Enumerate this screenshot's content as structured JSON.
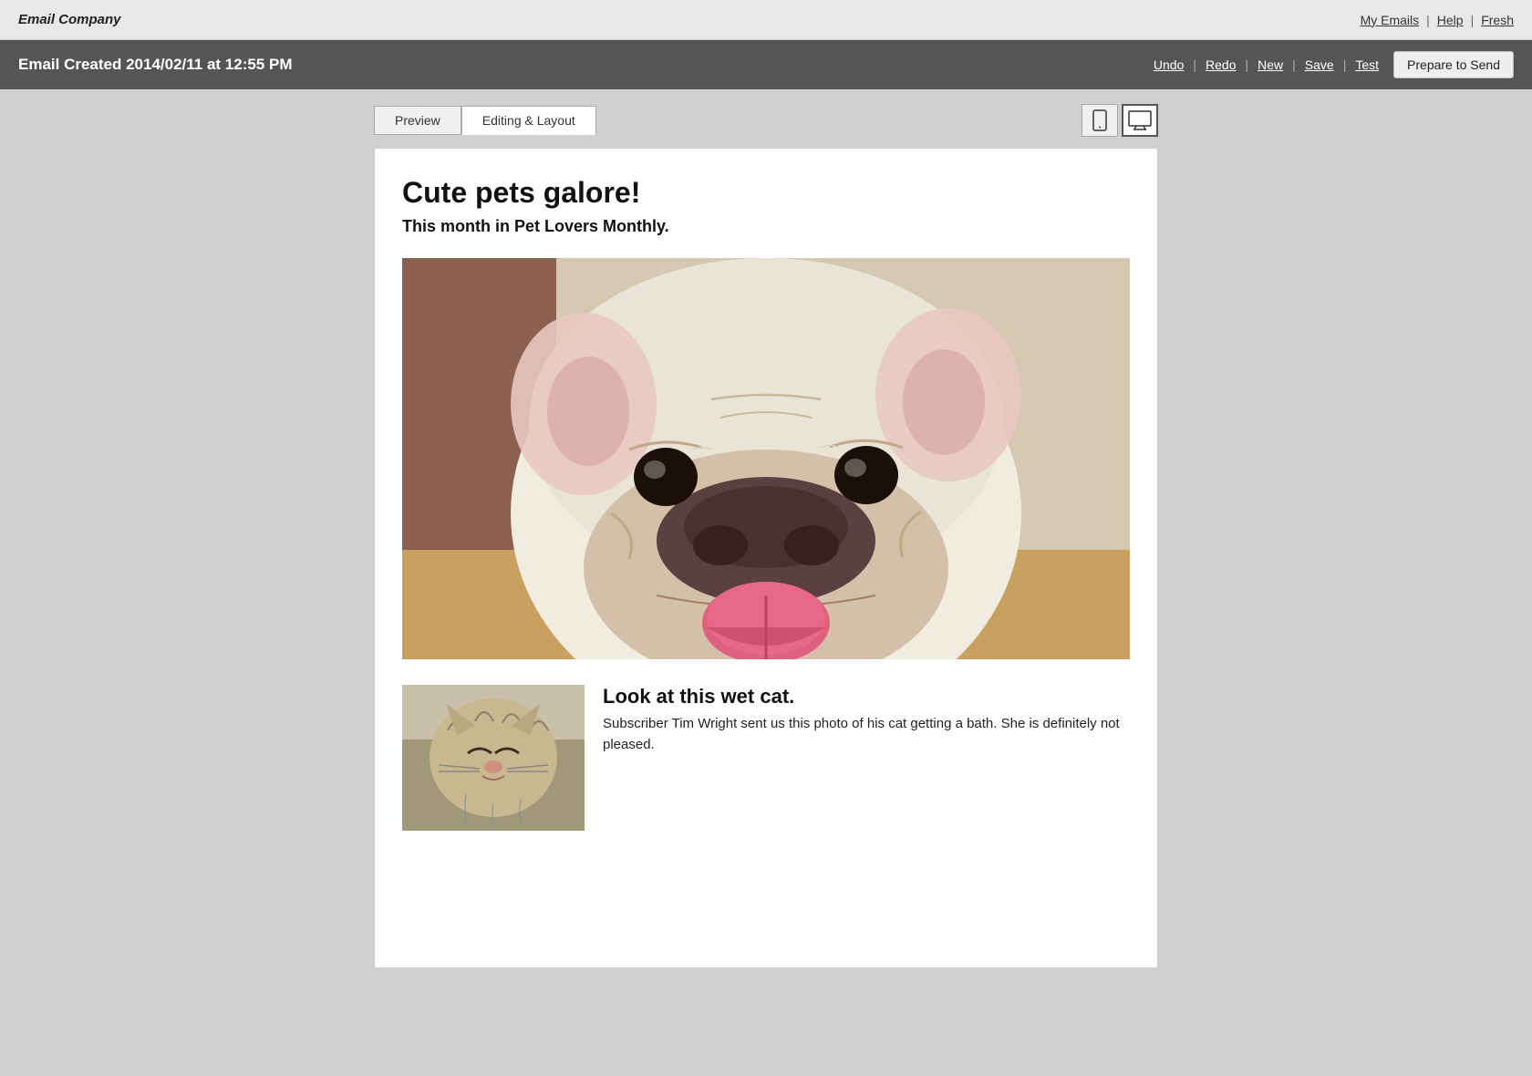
{
  "brand": {
    "name": "Email Company"
  },
  "topnav": {
    "links": [
      {
        "label": "My Emails",
        "id": "my-emails"
      },
      {
        "label": "Help",
        "id": "help"
      },
      {
        "label": "Fresh",
        "id": "fresh"
      }
    ]
  },
  "toolbar": {
    "title": "Email Created 2014/02/11 at 12:55 PM",
    "actions": [
      {
        "label": "Undo",
        "id": "undo"
      },
      {
        "label": "Redo",
        "id": "redo"
      },
      {
        "label": "New",
        "id": "new"
      },
      {
        "label": "Save",
        "id": "save"
      },
      {
        "label": "Test",
        "id": "test"
      }
    ],
    "prepare_btn": "Prepare to Send"
  },
  "tabs": {
    "items": [
      {
        "label": "Preview",
        "active": false
      },
      {
        "label": "Editing & Layout",
        "active": true
      }
    ]
  },
  "email": {
    "title": "Cute pets galore!",
    "subtitle": "This month in Pet Lovers Monthly.",
    "main_image_alt": "French bulldog close-up photo",
    "bottom_section": {
      "image_alt": "Wet cat photo",
      "heading": "Look at this wet cat.",
      "body": "Subscriber Tim Wright sent us this photo of his cat getting a bath. She is definitely not pleased."
    }
  },
  "devices": {
    "mobile_label": "Mobile view",
    "desktop_label": "Desktop view"
  }
}
